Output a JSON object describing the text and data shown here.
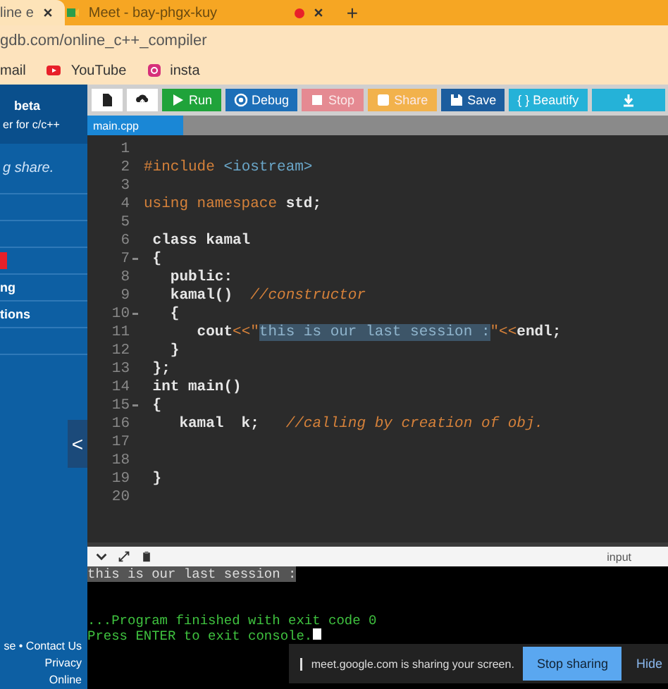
{
  "browser": {
    "tabs": [
      {
        "label": "line e",
        "selected": true,
        "recording": false
      },
      {
        "label": "Meet - bay-phgx-kuy",
        "selected": false,
        "recording": true
      }
    ],
    "new_tab": "+",
    "address": "gdb.com/online_c++_compiler",
    "bookmarks": [
      {
        "label": "mail",
        "kind": "plain"
      },
      {
        "label": "YouTube",
        "kind": "youtube"
      },
      {
        "label": "insta",
        "kind": "instagram"
      }
    ]
  },
  "sidebar": {
    "brand": "beta",
    "tagline": "er for c/c++",
    "slogan": "g  share.",
    "items": [
      {
        "marked": false
      },
      {
        "marked": false
      },
      {
        "marked": true
      },
      {
        "label": "ng",
        "marked": false
      },
      {
        "label": "tions",
        "marked": false
      },
      {
        "marked": false
      }
    ],
    "collapse": "<",
    "footer_links": [
      "se • Contact Us",
      "Privacy",
      "Online"
    ]
  },
  "toolbar": {
    "icon_buttons": [
      {
        "kind": "file"
      },
      {
        "kind": "upload"
      }
    ],
    "buttons": [
      {
        "label": "Run",
        "kind": "play",
        "color": "#1fa33a",
        "disabled": false
      },
      {
        "label": "Debug",
        "kind": "debug",
        "color": "#1d6fb8",
        "disabled": false
      },
      {
        "label": "Stop",
        "kind": "stop",
        "color": "#e58a92",
        "disabled": true
      },
      {
        "label": "Share",
        "kind": "share",
        "color": "#f2b24c",
        "disabled": true
      },
      {
        "label": "Save",
        "kind": "save",
        "color": "#1c5d9e",
        "disabled": false
      },
      {
        "label": "{ } Beautify",
        "kind": "text",
        "color": "#25b2d8",
        "disabled": false
      },
      {
        "kind": "download",
        "color": "#25b2d8",
        "disabled": false
      }
    ]
  },
  "editor": {
    "file_tab": "main.cpp",
    "lines": [
      {
        "number": "1",
        "foldable": false
      },
      {
        "number": "2",
        "foldable": false,
        "tokens": [
          {
            "text": "#include ",
            "kind": "keyword"
          },
          {
            "text": "<iostream>",
            "kind": "include"
          }
        ]
      },
      {
        "number": "3",
        "foldable": false
      },
      {
        "number": "4",
        "foldable": false,
        "tokens": [
          {
            "text": "using namespace ",
            "kind": "keyword"
          },
          {
            "text": "std;",
            "kind": "plain"
          }
        ]
      },
      {
        "number": "5",
        "foldable": false
      },
      {
        "number": "6",
        "foldable": false,
        "tokens": [
          {
            "text": " class kamal",
            "kind": "plain"
          }
        ]
      },
      {
        "number": "7",
        "foldable": true,
        "tokens": [
          {
            "text": " {",
            "kind": "plain"
          }
        ]
      },
      {
        "number": "8",
        "foldable": false,
        "tokens": [
          {
            "text": "   public:",
            "kind": "plain"
          }
        ]
      },
      {
        "number": "9",
        "foldable": false,
        "tokens": [
          {
            "text": "   kamal()  ",
            "kind": "plain"
          },
          {
            "text": "//constructor",
            "kind": "comment"
          }
        ]
      },
      {
        "number": "10",
        "foldable": true,
        "tokens": [
          {
            "text": "   {",
            "kind": "plain"
          }
        ]
      },
      {
        "number": "11",
        "foldable": false,
        "tokens": [
          {
            "text": "      cout",
            "kind": "plain"
          },
          {
            "text": "<<\"",
            "kind": "operator"
          },
          {
            "text": "this is our last session :",
            "kind": "selected"
          },
          {
            "text": "\"<<",
            "kind": "operator"
          },
          {
            "text": "endl;",
            "kind": "plain"
          }
        ]
      },
      {
        "number": "12",
        "foldable": false,
        "tokens": [
          {
            "text": "   }",
            "kind": "plain"
          }
        ]
      },
      {
        "number": "13",
        "foldable": false,
        "tokens": [
          {
            "text": " };",
            "kind": "plain"
          }
        ]
      },
      {
        "number": "14",
        "foldable": false,
        "tokens": [
          {
            "text": " int main()",
            "kind": "plain"
          }
        ]
      },
      {
        "number": "15",
        "foldable": true,
        "tokens": [
          {
            "text": " {",
            "kind": "plain"
          }
        ]
      },
      {
        "number": "16",
        "foldable": false,
        "tokens": [
          {
            "text": "    kamal  k;   ",
            "kind": "plain"
          },
          {
            "text": "//calling by creation of obj.",
            "kind": "comment"
          }
        ]
      },
      {
        "number": "17",
        "foldable": false
      },
      {
        "number": "18",
        "foldable": false
      },
      {
        "number": "19",
        "foldable": false,
        "tokens": [
          {
            "text": " }",
            "kind": "plain"
          }
        ]
      },
      {
        "number": "20",
        "foldable": false
      }
    ]
  },
  "console": {
    "input_label": "input",
    "lines": [
      {
        "text": "this is our last session :",
        "kind": "selected"
      },
      {
        "kind": "blank"
      },
      {
        "kind": "blank"
      },
      {
        "text": "...Program finished with exit code 0",
        "kind": "status"
      },
      {
        "text": "Press ENTER to exit console.",
        "kind": "status"
      }
    ]
  },
  "share_notice": {
    "message": "meet.google.com is sharing your screen.",
    "stop": "Stop sharing",
    "hide": "Hide"
  }
}
